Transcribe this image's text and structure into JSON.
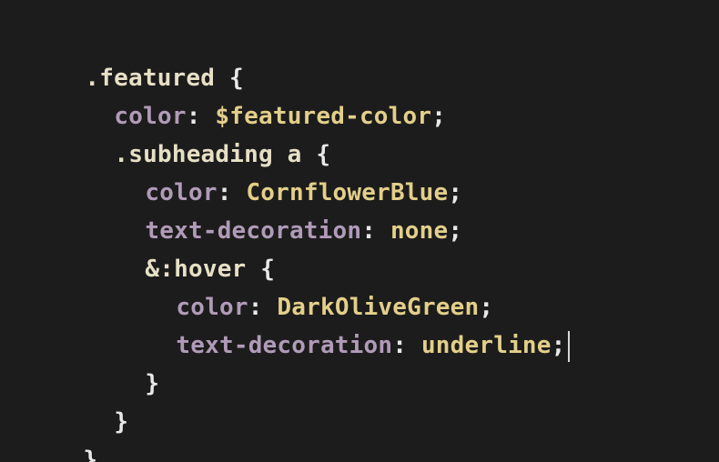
{
  "code": {
    "l1": {
      "selector": ".featured",
      "brace": " {"
    },
    "l2": {
      "property": "color",
      "colon": ": ",
      "value": "$featured-color",
      "semi": ";"
    },
    "l3": {
      "selector": ".subheading a",
      "brace": " {"
    },
    "l4": {
      "property": "color",
      "colon": ": ",
      "value": "CornflowerBlue",
      "semi": ";"
    },
    "l5": {
      "property": "text-decoration",
      "colon": ": ",
      "value": "none",
      "semi": ";"
    },
    "l6": {
      "selector": "&:hover",
      "brace": " {"
    },
    "l7": {
      "property": "color",
      "colon": ": ",
      "value": "DarkOliveGreen",
      "semi": ";"
    },
    "l8": {
      "property": "text-decoration",
      "colon": ": ",
      "value": "underline",
      "semi": ";"
    },
    "l9": {
      "brace": "}"
    },
    "l10": {
      "brace": "}"
    },
    "l11": {
      "brace": "}"
    }
  },
  "colors": {
    "background": "#1c1c1c",
    "selector": "#e7e0c6",
    "property": "#b09bb8",
    "value": "#e3cf8a",
    "punctuation": "#e8e8e8"
  }
}
